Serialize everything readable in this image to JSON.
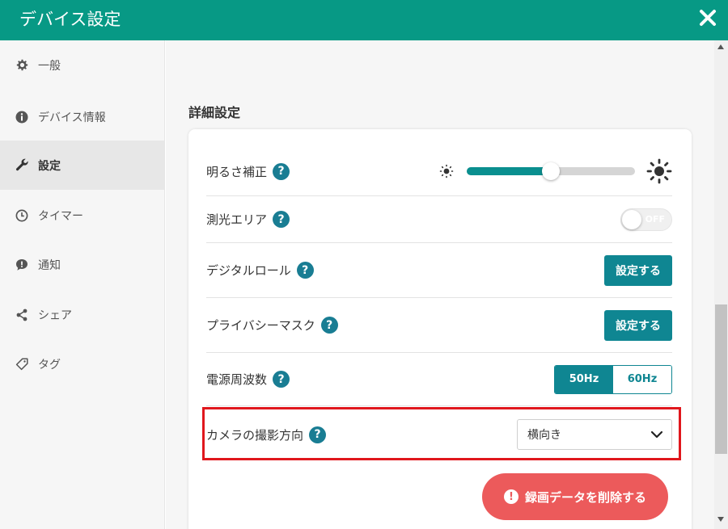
{
  "header": {
    "title": "デバイス設定"
  },
  "sidebar": {
    "items": [
      {
        "label": "一般",
        "icon": "gear-icon"
      },
      {
        "label": "デバイス情報",
        "icon": "info-icon"
      },
      {
        "label": "設定",
        "icon": "wrench-icon",
        "active": true
      },
      {
        "label": "タイマー",
        "icon": "clock-icon"
      },
      {
        "label": "通知",
        "icon": "notification-icon"
      },
      {
        "label": "シェア",
        "icon": "share-icon"
      },
      {
        "label": "タグ",
        "icon": "tag-icon"
      }
    ]
  },
  "main": {
    "section_title": "詳細設定",
    "rows": {
      "brightness": {
        "label": "明るさ補正",
        "help": "?",
        "value_percent": 50
      },
      "metering": {
        "label": "測光エリア",
        "help": "?",
        "toggle": "OFF"
      },
      "digital_roll": {
        "label": "デジタルロール",
        "help": "?",
        "button": "設定する"
      },
      "privacy_mask": {
        "label": "プライバシーマスク",
        "help": "?",
        "button": "設定する"
      },
      "power_freq": {
        "label": "電源周波数",
        "help": "?",
        "options": [
          "50Hz",
          "60Hz"
        ],
        "selected": "50Hz"
      },
      "camera_orientation": {
        "label": "カメラの撮影方向",
        "help": "?",
        "select_value": "横向き"
      }
    },
    "delete_button": {
      "icon": "!",
      "label": "録画データを削除する"
    }
  },
  "colors": {
    "header": "#079985",
    "teal_button": "#0f8692",
    "delete_button": "#ec5a5b",
    "highlight": "#e0171d"
  }
}
